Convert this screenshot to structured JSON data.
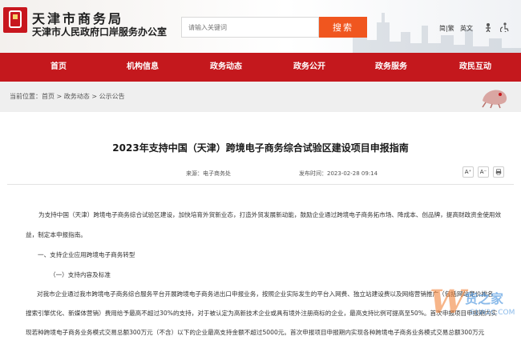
{
  "header": {
    "org_name": "天津市商务局",
    "org_subtitle": "天津市人民政府口岸服务办公室",
    "search": {
      "placeholder": "请输入关键词",
      "button_label": "搜索"
    },
    "lang_simplified": "简|繁",
    "lang_english": "英文",
    "colors": {
      "accent": "#c4181d",
      "search_button": "#f0561f"
    }
  },
  "nav": {
    "items": [
      {
        "label": "首页"
      },
      {
        "label": "机构信息"
      },
      {
        "label": "政务动态"
      },
      {
        "label": "政务公开"
      },
      {
        "label": "政务服务"
      },
      {
        "label": "政民互动"
      }
    ]
  },
  "breadcrumb": {
    "prefix": "当前位置：",
    "items": [
      "首页",
      "政务动态",
      "公示公告"
    ],
    "separator": " > "
  },
  "article": {
    "title": "2023年支持中国（天津）跨境电子商务综合试验区建设项目申报指南",
    "source_label": "来源：",
    "source": "电子商务处",
    "date_label": "发布时间：",
    "date": "2023-02-28 09:14",
    "tools": {
      "font_larger": "A⁺",
      "font_smaller": "A⁻",
      "print_icon": "print-icon"
    },
    "paragraphs": [
      "为支持中国（天津）跨境电子商务综合试验区建设，加快培育外贸新业态，打造外贸发展新动能，鼓励企业通过跨境电子商务拓市场、降成本、创品牌，提高财政资金使用效",
      "益，制定本申报指南。",
      "一、支持企业应用跨境电子商务转型",
      "（一）支持内容及标准",
      "对我市企业通过我市跨境电子商务综合服务平台开展跨境电子商务进出口申报业务，按照企业实际发生的平台入网费、独立站建设费以及网络营销推广（包括网站竞价排名",
      "搜索引擎优化、新媒体营销）费用给予最高不超过30%的支持，对于被认定为高新技术企业或具有境外注册商标的企业，最高支持比例可提高至50%。首次申报项目申报期内实",
      "现若种跨境电子商务业务模式交易总额300万元（不含）以下的企业最高支持金额不超过5000元。首次申报项目申报期内实现各种跨境电子商务业务模式交易总额300万元"
    ]
  },
  "watermark": {
    "glyph": "W",
    "cn": "货之家",
    "en": "S1W2C.COM"
  }
}
